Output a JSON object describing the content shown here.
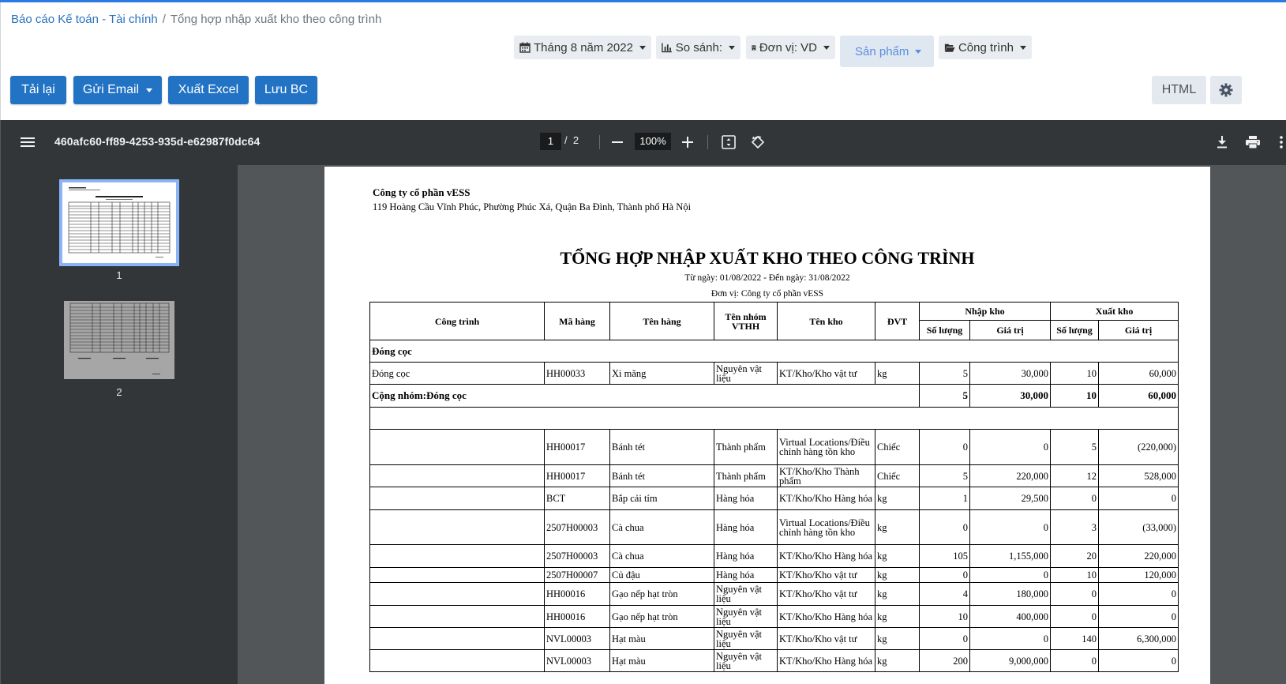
{
  "breadcrumb": {
    "parent": "Báo cáo Kế toán - Tài chính",
    "separator": "/",
    "current": "Tổng hợp nhập xuất kho theo công trình"
  },
  "filters": {
    "period": "Tháng 8 năm 2022",
    "compare": "So sánh:",
    "unit": "Đơn vị: VD",
    "product": "Sản phẩm",
    "project": "Công trình"
  },
  "toolbar": {
    "reload": "Tải lại",
    "email": "Gửi Email",
    "excel": "Xuất Excel",
    "save": "Lưu BC",
    "html": "HTML"
  },
  "viewer": {
    "filename": "460afc60-ff89-4253-935d-e62987f0dc64",
    "page_current": "1",
    "page_total": "2",
    "zoom": "100%"
  },
  "thumbnails": [
    {
      "label": "1"
    },
    {
      "label": "2"
    }
  ],
  "report": {
    "company": "Công ty cổ phần vESS",
    "address": "119 Hoàng Cầu Vĩnh Phúc, Phường Phúc Xá, Quận Ba Đình, Thành phố Hà Nội",
    "title": "TỔNG HỢP NHẬP XUẤT KHO THEO CÔNG TRÌNH",
    "date_range": "Từ ngày: 01/08/2022 - Đến ngày: 31/08/2022",
    "unit": "Đơn vị: Công ty cổ phần vESS",
    "headers": {
      "project": "Công trình",
      "code": "Mã hàng",
      "name": "Tên hàng",
      "group": "Tên nhóm VTHH",
      "warehouse": "Tên kho",
      "uom": "ĐVT",
      "import": "Nhập kho",
      "export": "Xuất kho",
      "qty": "Số lượng",
      "value": "Giá trị"
    },
    "group1": {
      "title": "Đóng cọc",
      "row": {
        "project": "Đóng cọc",
        "code": "HH00033",
        "name": "Xi măng",
        "group": "Nguyên vật liệu",
        "warehouse": "KT/Kho/Kho vật tư",
        "uom": "kg",
        "in_qty": "5",
        "in_val": "30,000",
        "out_qty": "10",
        "out_val": "60,000"
      },
      "subtotal": {
        "label": "Cộng nhóm:Đóng cọc",
        "in_qty": "5",
        "in_val": "30,000",
        "out_qty": "10",
        "out_val": "60,000"
      }
    },
    "rows": [
      {
        "code": "HH00017",
        "name": "Bánh tét",
        "group": "Thành phẩm",
        "warehouse": "Virtual Locations/Điều chỉnh hàng tồn kho",
        "uom": "Chiếc",
        "in_qty": "0",
        "in_val": "0",
        "out_qty": "5",
        "out_val": "(220,000)"
      },
      {
        "code": "HH00017",
        "name": "Bánh tét",
        "group": "Thành phẩm",
        "warehouse": "KT/Kho/Kho Thành phẩm",
        "uom": "Chiếc",
        "in_qty": "5",
        "in_val": "220,000",
        "out_qty": "12",
        "out_val": "528,000"
      },
      {
        "code": "BCT",
        "name": "Bắp cải tím",
        "group": "Hàng hóa",
        "warehouse": "KT/Kho/Kho Hàng hóa",
        "uom": "kg",
        "in_qty": "1",
        "in_val": "29,500",
        "out_qty": "0",
        "out_val": "0"
      },
      {
        "code": "2507H00003",
        "name": "Cà chua",
        "group": "Hàng hóa",
        "warehouse": "Virtual Locations/Điều chỉnh hàng tồn kho",
        "uom": "kg",
        "in_qty": "0",
        "in_val": "0",
        "out_qty": "3",
        "out_val": "(33,000)"
      },
      {
        "code": "2507H00003",
        "name": "Cà chua",
        "group": "Hàng hóa",
        "warehouse": "KT/Kho/Kho Hàng hóa",
        "uom": "kg",
        "in_qty": "105",
        "in_val": "1,155,000",
        "out_qty": "20",
        "out_val": "220,000"
      },
      {
        "code": "2507H00007",
        "name": "Củ đậu",
        "group": "Hàng hóa",
        "warehouse": "KT/Kho/Kho vật tư",
        "uom": "kg",
        "in_qty": "0",
        "in_val": "0",
        "out_qty": "10",
        "out_val": "120,000"
      },
      {
        "code": "HH00016",
        "name": "Gạo nếp hạt tròn",
        "group": "Nguyên vật liệu",
        "warehouse": "KT/Kho/Kho vật tư",
        "uom": "kg",
        "in_qty": "4",
        "in_val": "180,000",
        "out_qty": "0",
        "out_val": "0"
      },
      {
        "code": "HH00016",
        "name": "Gạo nếp hạt tròn",
        "group": "Nguyên vật liệu",
        "warehouse": "KT/Kho/Kho Hàng hóa",
        "uom": "kg",
        "in_qty": "10",
        "in_val": "400,000",
        "out_qty": "0",
        "out_val": "0"
      },
      {
        "code": "NVL00003",
        "name": "Hạt màu",
        "group": "Nguyên vật liệu",
        "warehouse": "KT/Kho/Kho vật tư",
        "uom": "kg",
        "in_qty": "0",
        "in_val": "0",
        "out_qty": "140",
        "out_val": "6,300,000"
      },
      {
        "code": "NVL00003",
        "name": "Hạt màu",
        "group": "Nguyên vật liệu",
        "warehouse": "KT/Kho/Kho Hàng hóa",
        "uom": "kg",
        "in_qty": "200",
        "in_val": "9,000,000",
        "out_qty": "0",
        "out_val": "0"
      }
    ]
  }
}
